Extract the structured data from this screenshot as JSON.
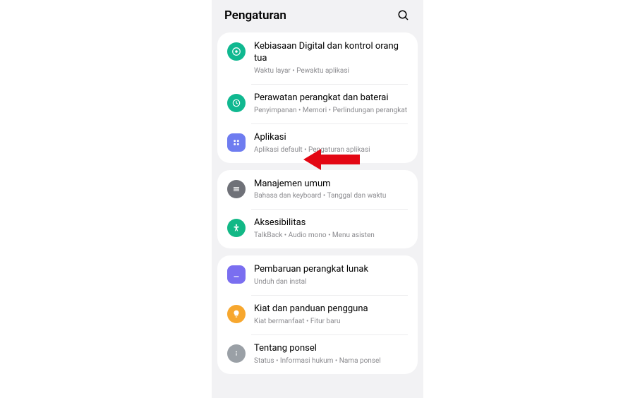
{
  "header": {
    "title": "Pengaturan"
  },
  "groups": [
    {
      "items": [
        {
          "title": "Kebiasaan Digital dan kontrol orang tua",
          "subtitle": "Waktu layar • Pewaktu aplikasi",
          "icon": "wellbeing",
          "color": "#10b890"
        },
        {
          "title": "Perawatan perangkat dan baterai",
          "subtitle": "Penyimpanan • Memori • Perlindungan perangkat",
          "icon": "care",
          "color": "#10b890"
        },
        {
          "title": "Aplikasi",
          "subtitle": "Aplikasi default • Pengaturan aplikasi",
          "icon": "apps",
          "color": "#6e7cf0"
        }
      ]
    },
    {
      "items": [
        {
          "title": "Manajemen umum",
          "subtitle": "Bahasa dan keyboard • Tanggal dan waktu",
          "icon": "general",
          "color": "#6f7178"
        },
        {
          "title": "Aksesibilitas",
          "subtitle": "TalkBack • Audio mono • Menu asisten",
          "icon": "accessibility",
          "color": "#12b886"
        }
      ]
    },
    {
      "items": [
        {
          "title": "Pembaruan perangkat lunak",
          "subtitle": "Unduh dan instal",
          "icon": "update",
          "color": "#7a6ef0"
        },
        {
          "title": "Kiat dan panduan pengguna",
          "subtitle": "Kiat bermanfaat • Fitur baru",
          "icon": "tips",
          "color": "#f7a72e"
        },
        {
          "title": "Tentang ponsel",
          "subtitle": "Status • Informasi hukum • Nama ponsel",
          "icon": "about",
          "color": "#9aa0a6"
        }
      ]
    }
  ]
}
